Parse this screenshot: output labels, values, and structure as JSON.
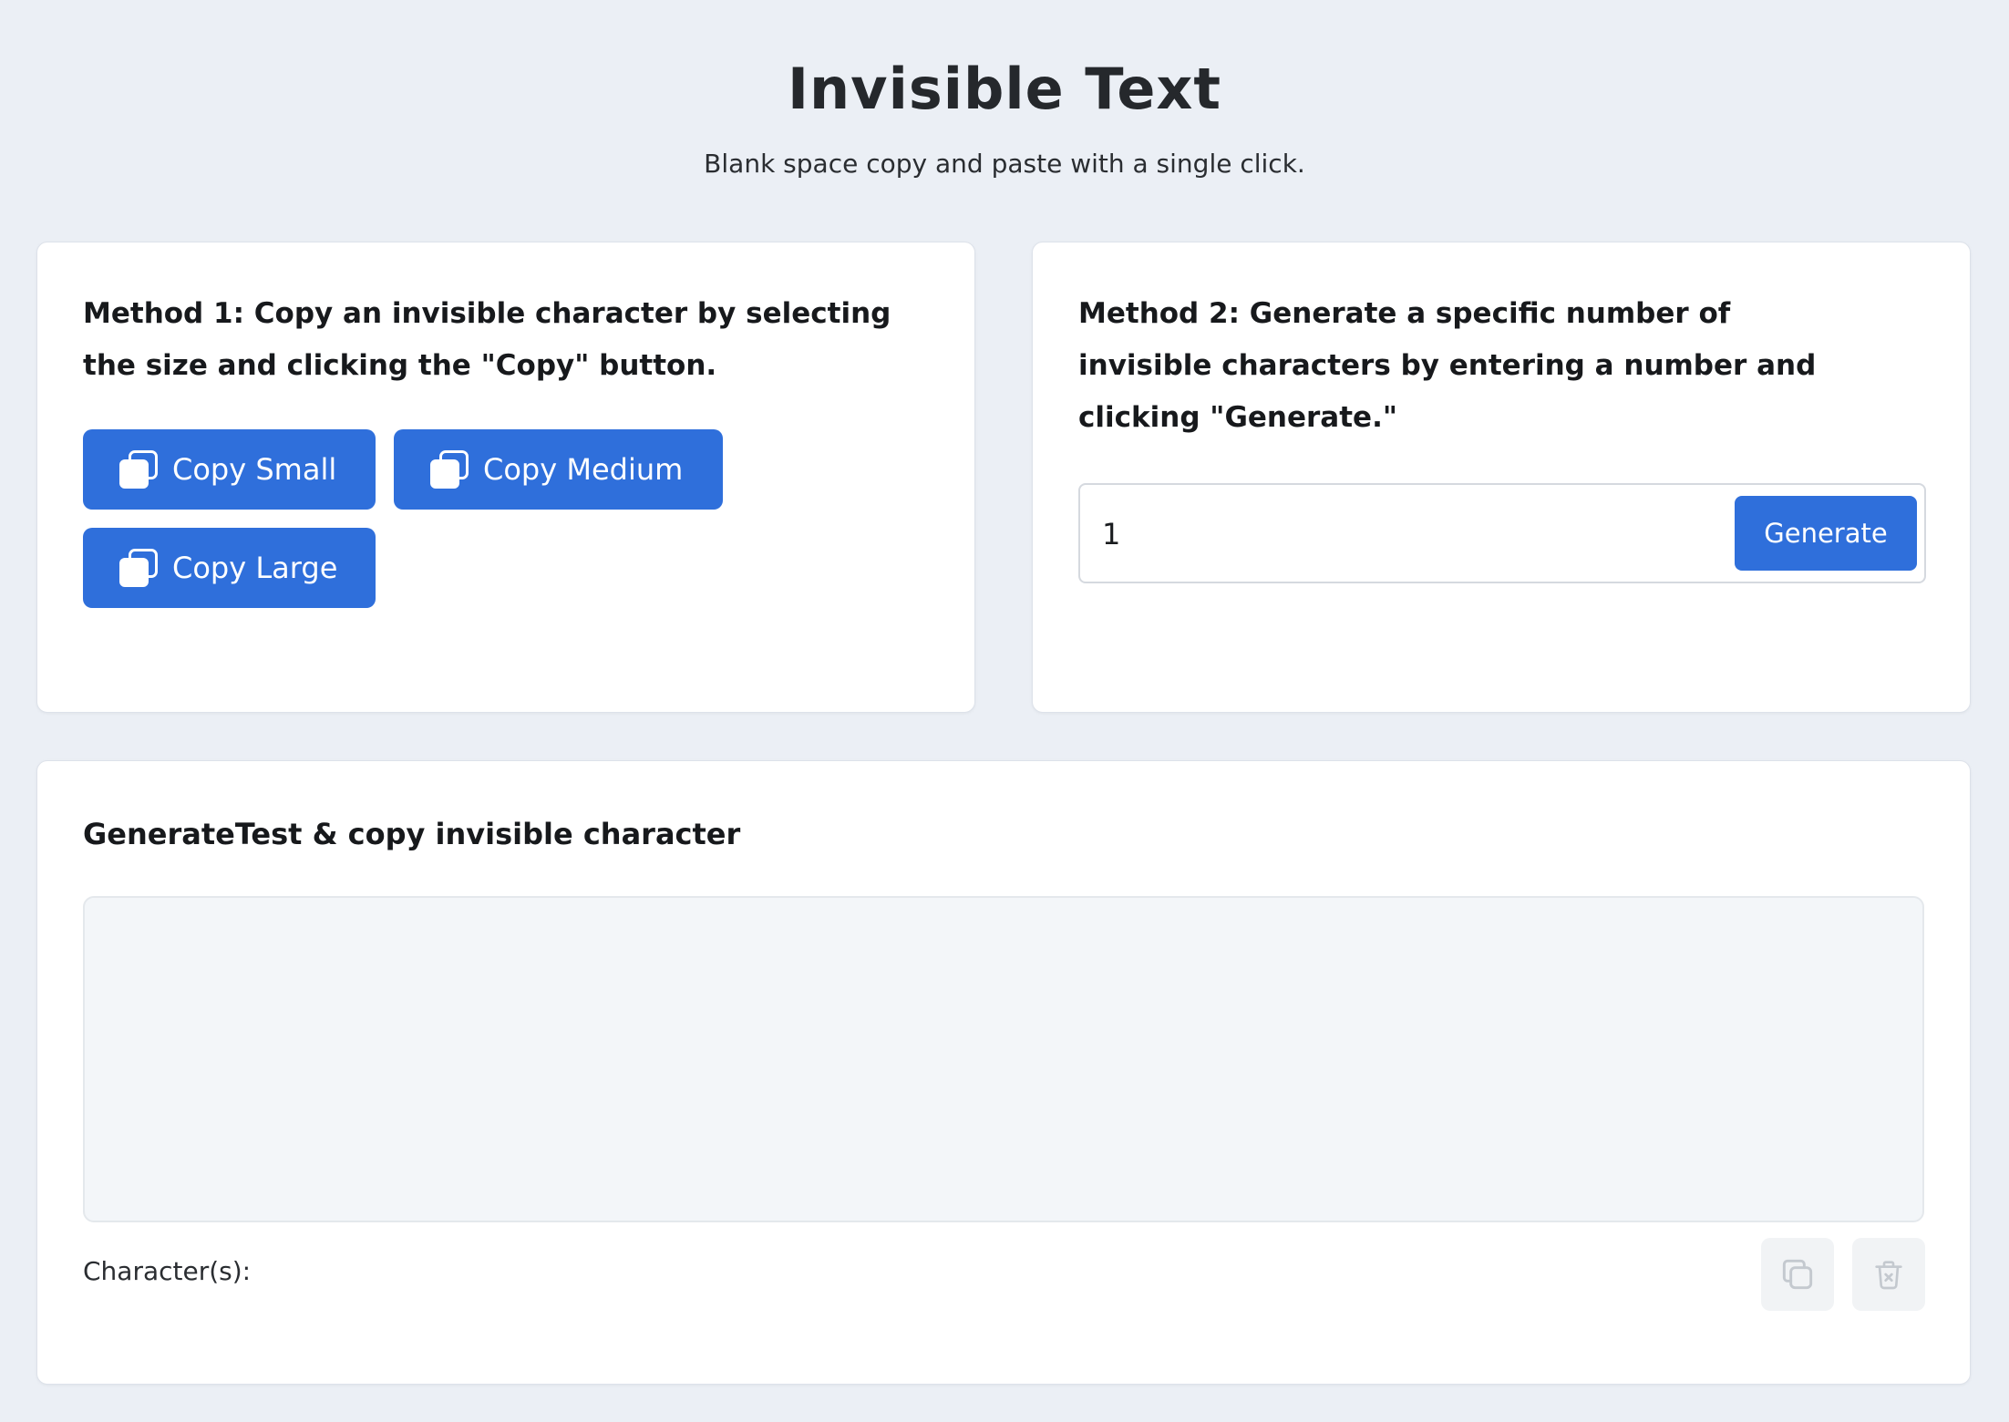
{
  "header": {
    "title": "Invisible Text",
    "subtitle": "Blank space copy and paste with a single click."
  },
  "method1": {
    "description": "Method 1: Copy an invisible character by selecting the size and clicking the \"Copy\" button.",
    "buttons": [
      {
        "label": "Copy Small",
        "icon": "copy-icon"
      },
      {
        "label": "Copy Medium",
        "icon": "copy-icon"
      },
      {
        "label": "Copy Large",
        "icon": "copy-icon"
      }
    ]
  },
  "method2": {
    "description": "Method 2: Generate a specific number of invisible characters by entering a number and clicking \"Generate.\"",
    "input_value": "1",
    "button_label": "Generate"
  },
  "generator": {
    "title": "GenerateTest & copy invisible character",
    "output_value": "",
    "char_label": "Character(s):",
    "char_count": "",
    "copy_icon": "copy-icon",
    "delete_icon": "trash-icon"
  },
  "colors": {
    "background": "#ebeff5",
    "accent": "#2f6fdb",
    "card": "#ffffff",
    "icon_button_bg": "#f1f3f5"
  }
}
